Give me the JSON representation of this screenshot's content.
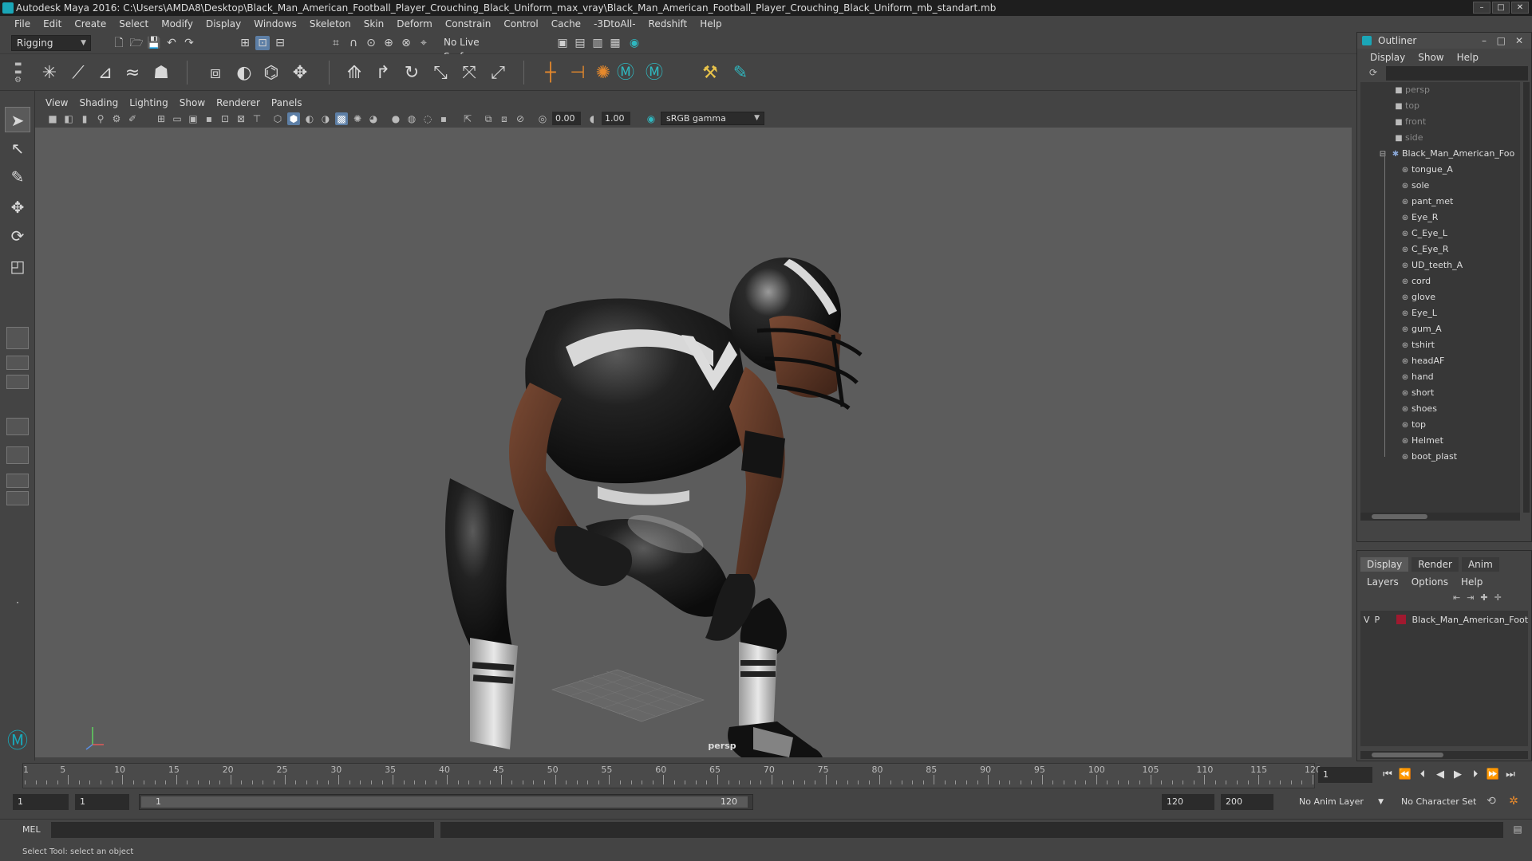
{
  "window": {
    "title": "Autodesk Maya 2016: C:\\Users\\AMDA8\\Desktop\\Black_Man_American_Football_Player_Crouching_Black_Uniform_max_vray\\Black_Man_American_Football_Player_Crouching_Black_Uniform_mb_standart.mb"
  },
  "menubar": [
    "File",
    "Edit",
    "Create",
    "Select",
    "Modify",
    "Display",
    "Windows",
    "Skeleton",
    "Skin",
    "Deform",
    "Constrain",
    "Control",
    "Cache",
    "-3DtoAll-",
    "Redshift",
    "Help"
  ],
  "statusline": {
    "mode": "Rigging",
    "live_surface": "No Live Surface"
  },
  "panel": {
    "menus": [
      "View",
      "Shading",
      "Lighting",
      "Show",
      "Renderer",
      "Panels"
    ],
    "exposure": "0.00",
    "gamma": "1.00",
    "color_space": "sRGB gamma",
    "camera_label": "persp"
  },
  "outliner": {
    "title": "Outliner",
    "menus": [
      "Display",
      "Show",
      "Help"
    ],
    "cameras": [
      "persp",
      "top",
      "front",
      "side"
    ],
    "group": "Black_Man_American_Foo",
    "children": [
      "tongue_A",
      "sole",
      "pant_met",
      "Eye_R",
      "C_Eye_L",
      "C_Eye_R",
      "UD_teeth_A",
      "cord",
      "glove",
      "Eye_L",
      "gum_A",
      "tshirt",
      "headAF",
      "hand",
      "short",
      "shoes",
      "top",
      "Helmet",
      "boot_plast"
    ]
  },
  "layers": {
    "tabs": [
      "Display",
      "Render",
      "Anim"
    ],
    "menus": [
      "Layers",
      "Options",
      "Help"
    ],
    "layer": {
      "v": "V",
      "p": "P",
      "name": "Black_Man_American_Footba",
      "color": "#a0192f"
    }
  },
  "timeline": {
    "ticks": [
      "5",
      "10",
      "15",
      "20",
      "25",
      "30",
      "35",
      "40",
      "45",
      "50",
      "55",
      "60",
      "65",
      "70",
      "75",
      "80",
      "85",
      "90",
      "95",
      "100",
      "105",
      "110",
      "115",
      "120"
    ],
    "start_label": "1",
    "current_frame": "1"
  },
  "range": {
    "start": "1",
    "playback_start": "1",
    "bar_start": "1",
    "bar_end": "120",
    "playback_end": "120",
    "end": "200",
    "anim_layer": "No Anim Layer",
    "character_set": "No Character Set"
  },
  "cmdline": {
    "lang": "MEL"
  },
  "helpline": {
    "text": "Select Tool: select an object"
  },
  "colors": {
    "accent": "#5d7fa6",
    "maya_teal": "#1aa6b7"
  }
}
